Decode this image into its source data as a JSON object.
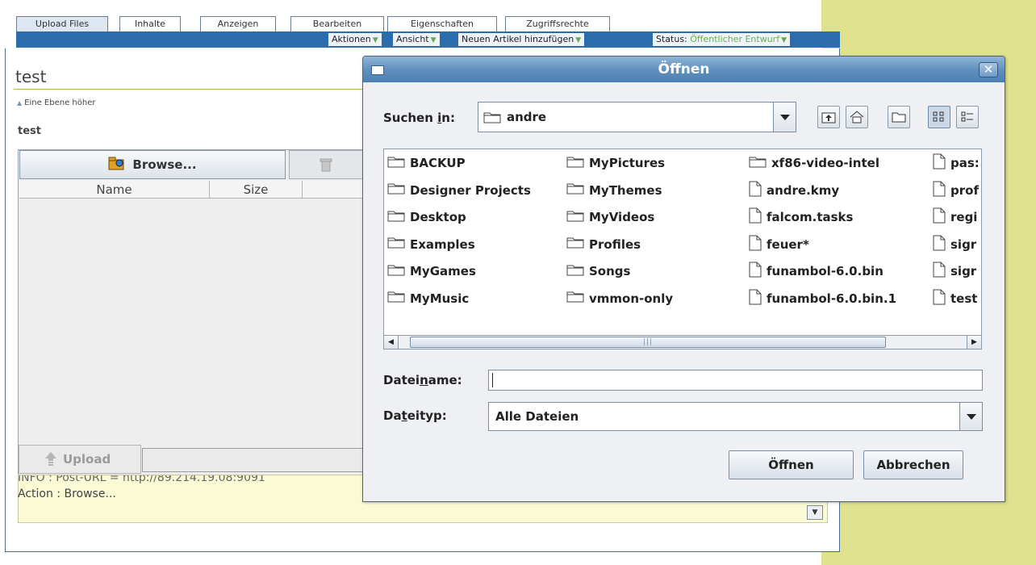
{
  "page": {
    "tabs": [
      "Upload Files",
      "Inhalte",
      "Anzeigen",
      "Bearbeiten",
      "Eigenschaften",
      "Zugriffsrechte"
    ],
    "actions": {
      "aktionen": "Aktionen",
      "ansicht": "Ansicht",
      "neuen_artikel": "Neuen Artikel hinzufügen",
      "status_label": "Status:",
      "status_value": "Öffentlicher Entwurf"
    },
    "title": "test",
    "up_level": "Eine Ebene höher",
    "subheading": "test",
    "applet": {
      "browse_label": "Browse...",
      "columns": [
        "Name",
        "Size"
      ],
      "upload_label": "Upload",
      "log_lines": [
        "INFO  : Post-URL = http://89.214.19.08:9091",
        "Action : Browse..."
      ]
    }
  },
  "dialog": {
    "title": "Öffnen",
    "look_in_label_pre": "Suchen ",
    "look_in_label_u": "i",
    "look_in_label_post": "n:",
    "look_in_value": "andre",
    "files": [
      {
        "name": "BACKUP",
        "type": "folder"
      },
      {
        "name": "Designer Projects",
        "type": "folder"
      },
      {
        "name": "Desktop",
        "type": "folder"
      },
      {
        "name": "Examples",
        "type": "folder"
      },
      {
        "name": "MyGames",
        "type": "folder"
      },
      {
        "name": "MyMusic",
        "type": "folder"
      },
      {
        "name": "MyPictures",
        "type": "folder"
      },
      {
        "name": "MyThemes",
        "type": "folder"
      },
      {
        "name": "MyVideos",
        "type": "folder"
      },
      {
        "name": "Profiles",
        "type": "folder"
      },
      {
        "name": "Songs",
        "type": "folder"
      },
      {
        "name": "vmmon-only",
        "type": "folder"
      },
      {
        "name": "xf86-video-intel",
        "type": "folder"
      },
      {
        "name": "andre.kmy",
        "type": "file"
      },
      {
        "name": "falcom.tasks",
        "type": "file"
      },
      {
        "name": "feuer*",
        "type": "file"
      },
      {
        "name": "funambol-6.0.bin",
        "type": "file"
      },
      {
        "name": "funambol-6.0.bin.1",
        "type": "file"
      },
      {
        "name": "pas:",
        "type": "file"
      },
      {
        "name": "prof",
        "type": "file"
      },
      {
        "name": "regi",
        "type": "file"
      },
      {
        "name": "sigr",
        "type": "file"
      },
      {
        "name": "sigr",
        "type": "file"
      },
      {
        "name": "test",
        "type": "file"
      }
    ],
    "filename_label_pre": "Datei",
    "filename_label_u": "n",
    "filename_label_post": "ame:",
    "filename_value": "",
    "filetype_label_pre": "Da",
    "filetype_label_u": "t",
    "filetype_label_post": "eityp:",
    "filetype_value": "Alle Dateien",
    "open_button": "Öffnen",
    "cancel_button": "Abbrechen"
  },
  "colors": {
    "titlebar": "#5d8ebc",
    "actionbar": "#2b6cad",
    "sidebar": "#dfe18d",
    "status_green": "#6ab04c"
  }
}
